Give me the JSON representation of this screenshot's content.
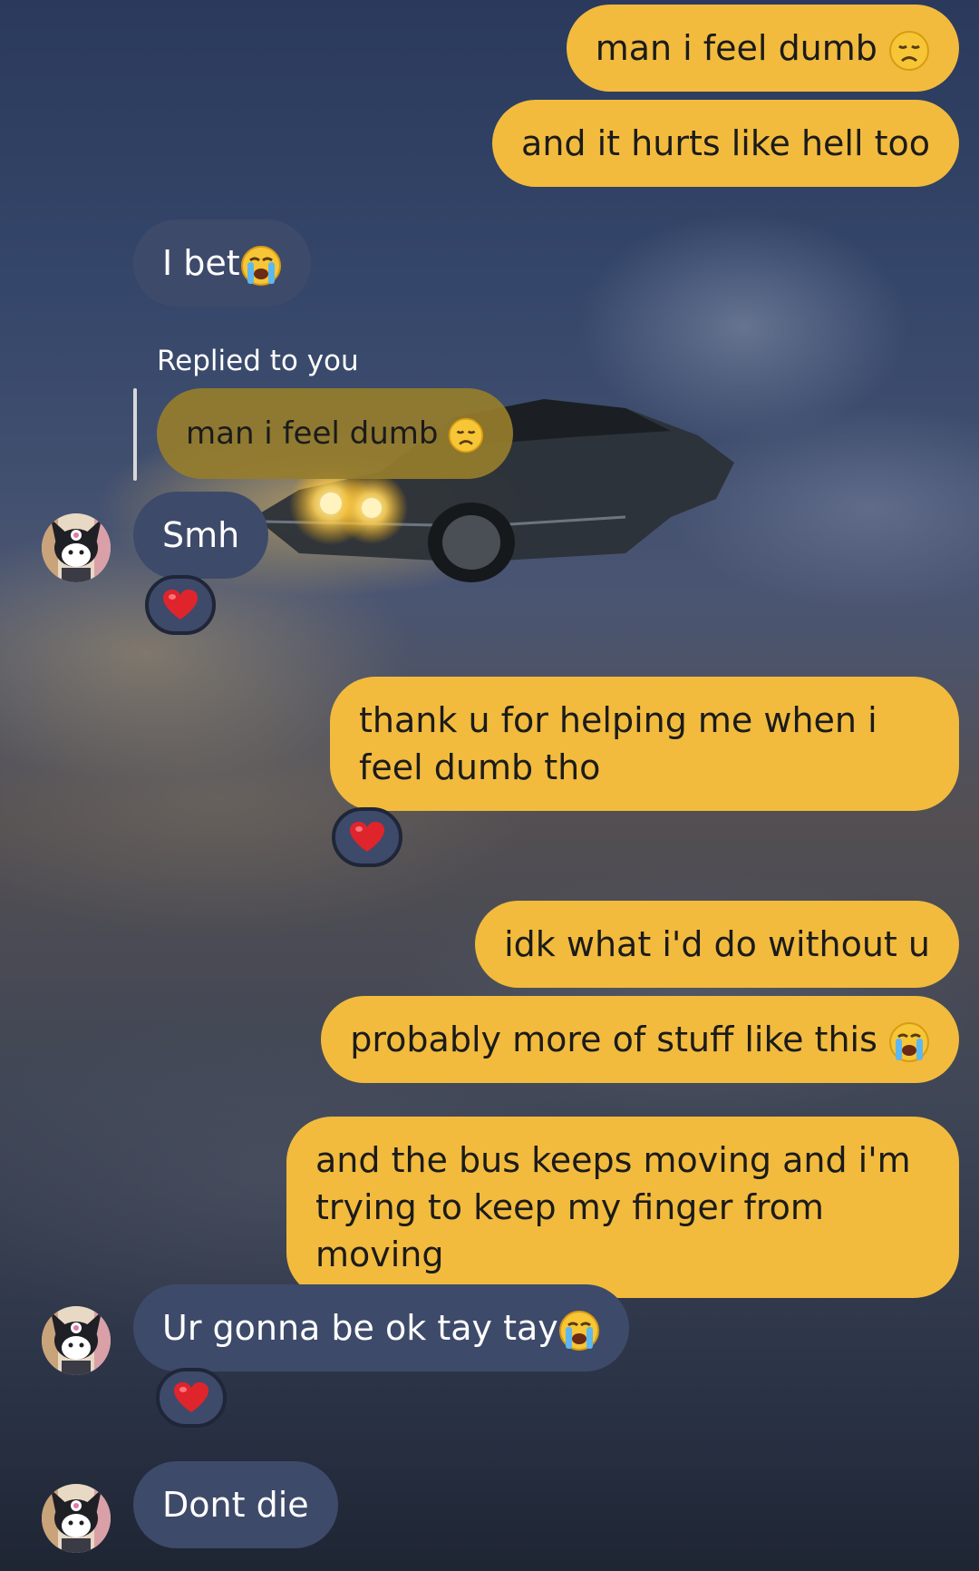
{
  "colors": {
    "outgoing_bubble": "#f2bb3d",
    "incoming_bubble": "#3e4a6a",
    "reply_quote": "#967d2d",
    "heart": "#e0242c"
  },
  "messages": [
    {
      "text": "man i feel dumb",
      "emoji": "disappointed-face-emoji"
    },
    {
      "text": "and it hurts like hell too"
    },
    {
      "text": "I bet",
      "emoji": "loudly-crying-face-emoji"
    },
    {
      "text": "Smh",
      "reaction": "red-heart-emoji",
      "reply": {
        "label": "Replied to you",
        "quote": "man i feel dumb",
        "emoji": "disappointed-face-emoji"
      }
    },
    {
      "text": "thank u for helping me when i feel dumb tho",
      "reaction": "red-heart-emoji"
    },
    {
      "text": "idk what i'd do without u"
    },
    {
      "text": "probably more of stuff like this",
      "emoji": "loudly-crying-face-emoji"
    },
    {
      "text": "and the bus keeps moving and i'm trying to keep my finger from moving"
    },
    {
      "text": "Ur gonna be ok tay tay",
      "emoji": "loudly-crying-face-emoji",
      "reaction": "red-heart-emoji"
    },
    {
      "text": "Dont die"
    }
  ],
  "avatar": {
    "icon": "kuromi-avatar-icon"
  }
}
